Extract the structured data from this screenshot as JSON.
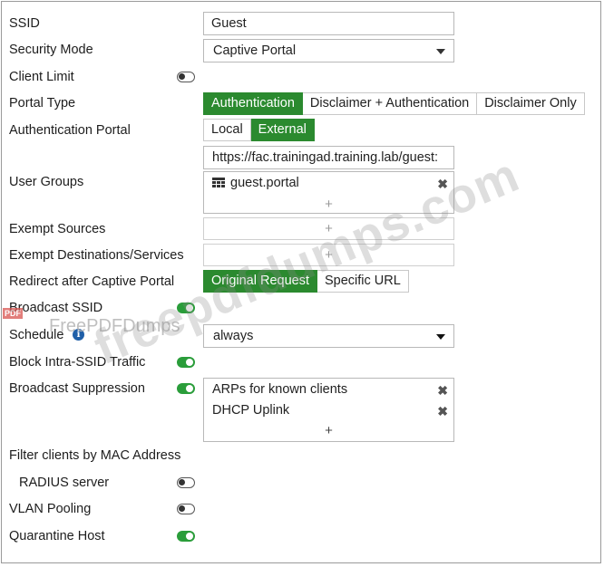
{
  "form": {
    "ssid": {
      "label": "SSID",
      "value": "Guest"
    },
    "security_mode": {
      "label": "Security Mode",
      "value": "Captive Portal"
    },
    "client_limit": {
      "label": "Client Limit",
      "enabled": false
    },
    "portal_type": {
      "label": "Portal Type",
      "options": [
        "Authentication",
        "Disclaimer + Authentication",
        "Disclaimer Only"
      ],
      "selected": "Authentication"
    },
    "authentication_portal": {
      "label": "Authentication Portal",
      "options": [
        "Local",
        "External"
      ],
      "selected": "External",
      "url": "https://fac.trainingad.training.lab/guest:"
    },
    "user_groups": {
      "label": "User Groups",
      "items": [
        "guest.portal"
      ],
      "add": "+"
    },
    "exempt_sources": {
      "label": "Exempt Sources",
      "add": "+"
    },
    "exempt_destinations": {
      "label": "Exempt Destinations/Services",
      "add": "+"
    },
    "redirect_after_portal": {
      "label": "Redirect after Captive Portal",
      "options": [
        "Original Request",
        "Specific URL"
      ],
      "selected": "Original Request"
    },
    "broadcast_ssid": {
      "label": "Broadcast SSID",
      "enabled": true
    },
    "schedule": {
      "label": "Schedule",
      "value": "always",
      "info_icon": "i"
    },
    "block_intra_ssid": {
      "label": "Block Intra-SSID Traffic",
      "enabled": true
    },
    "broadcast_suppression": {
      "label": "Broadcast Suppression",
      "enabled": true,
      "items": [
        "ARPs for known clients",
        "DHCP Uplink"
      ],
      "add": "+"
    },
    "filter_by_mac": {
      "label": "Filter clients by MAC Address"
    },
    "radius_server": {
      "label": "RADIUS server",
      "enabled": false
    },
    "vlan_pooling": {
      "label": "VLAN Pooling",
      "enabled": false
    },
    "quarantine_host": {
      "label": "Quarantine Host",
      "enabled": true
    }
  },
  "watermarks": {
    "site": "freepdfdumps.com",
    "brand": "FreePDFDumps",
    "badge": "PDF"
  },
  "colors": {
    "accent_green": "#2b8a2f",
    "toggle_on": "#2a9d3a",
    "info_blue": "#1f5fa8"
  },
  "icons": {
    "remove": "close-icon",
    "add": "plus-icon",
    "group": "user-group-icon",
    "dropdown": "chevron-down-icon"
  }
}
